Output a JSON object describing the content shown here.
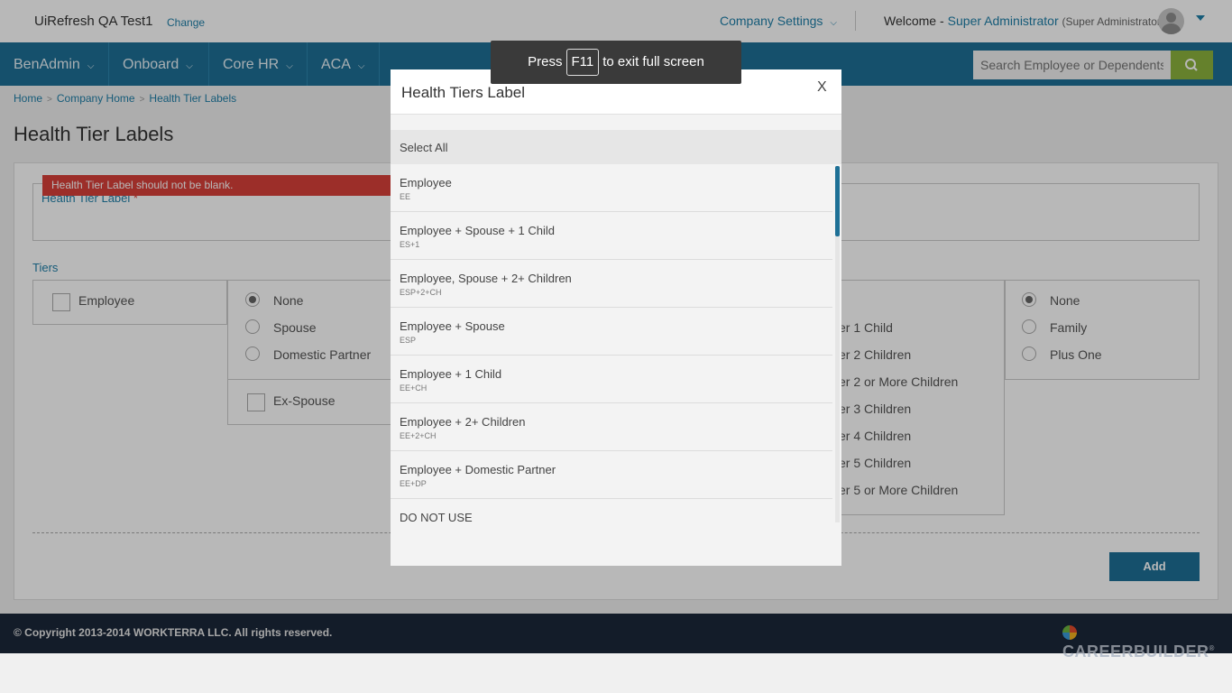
{
  "header": {
    "company": "UiRefresh QA Test1",
    "change": "Change",
    "company_settings": "Company Settings",
    "welcome": "Welcome -",
    "user": "Super Administrator",
    "role": "(Super Administrator)"
  },
  "nav": {
    "items": [
      {
        "label": "BenAdmin"
      },
      {
        "label": "Onboard"
      },
      {
        "label": "Core HR"
      },
      {
        "label": "ACA"
      }
    ],
    "search_placeholder": "Search Employee or Dependents"
  },
  "breadcrumb": [
    "Home",
    "Company Home",
    "Health Tier Labels"
  ],
  "page": {
    "title": "Health Tier Labels",
    "error": "Health Tier Label should not be blank.",
    "label_field": "Health Tier Label",
    "required": "*",
    "tiers": "Tiers",
    "add": "Add"
  },
  "tiers": {
    "employee": "Employee",
    "spouse_options": [
      "None",
      "Spouse",
      "Domestic Partner"
    ],
    "ex_spouse": "Ex-Spouse",
    "children_options": [
      "er 1 Child",
      "er 2 Children",
      "er 2 or More Children",
      "er 3 Children",
      "er 4 Children",
      "er 5 Children",
      "er 5 or More Children"
    ],
    "family_options": [
      "None",
      "Family",
      "Plus One"
    ]
  },
  "footer": {
    "copyright": "© Copyright 2013-2014 WORKTERRA LLC. All rights reserved.",
    "brand": "CAREERBUILDER",
    "brand_mark": "®"
  },
  "fullscreen": {
    "press": "Press",
    "key": "F11",
    "rest": "to exit full screen"
  },
  "modal": {
    "title": "Health Tiers Label",
    "close": "X",
    "select_all": "Select All",
    "items": [
      {
        "name": "Employee",
        "code": "EE"
      },
      {
        "name": "Employee + Spouse + 1 Child",
        "code": "ES+1"
      },
      {
        "name": "Employee, Spouse + 2+ Children",
        "code": "ESP+2+CH"
      },
      {
        "name": "Employee + Spouse",
        "code": "ESP"
      },
      {
        "name": "Employee + 1 Child",
        "code": "EE+CH"
      },
      {
        "name": "Employee + 2+ Children",
        "code": "EE+2+CH"
      },
      {
        "name": "Employee + Domestic Partner",
        "code": "EE+DP"
      },
      {
        "name": "DO NOT USE",
        "code": ""
      }
    ]
  }
}
